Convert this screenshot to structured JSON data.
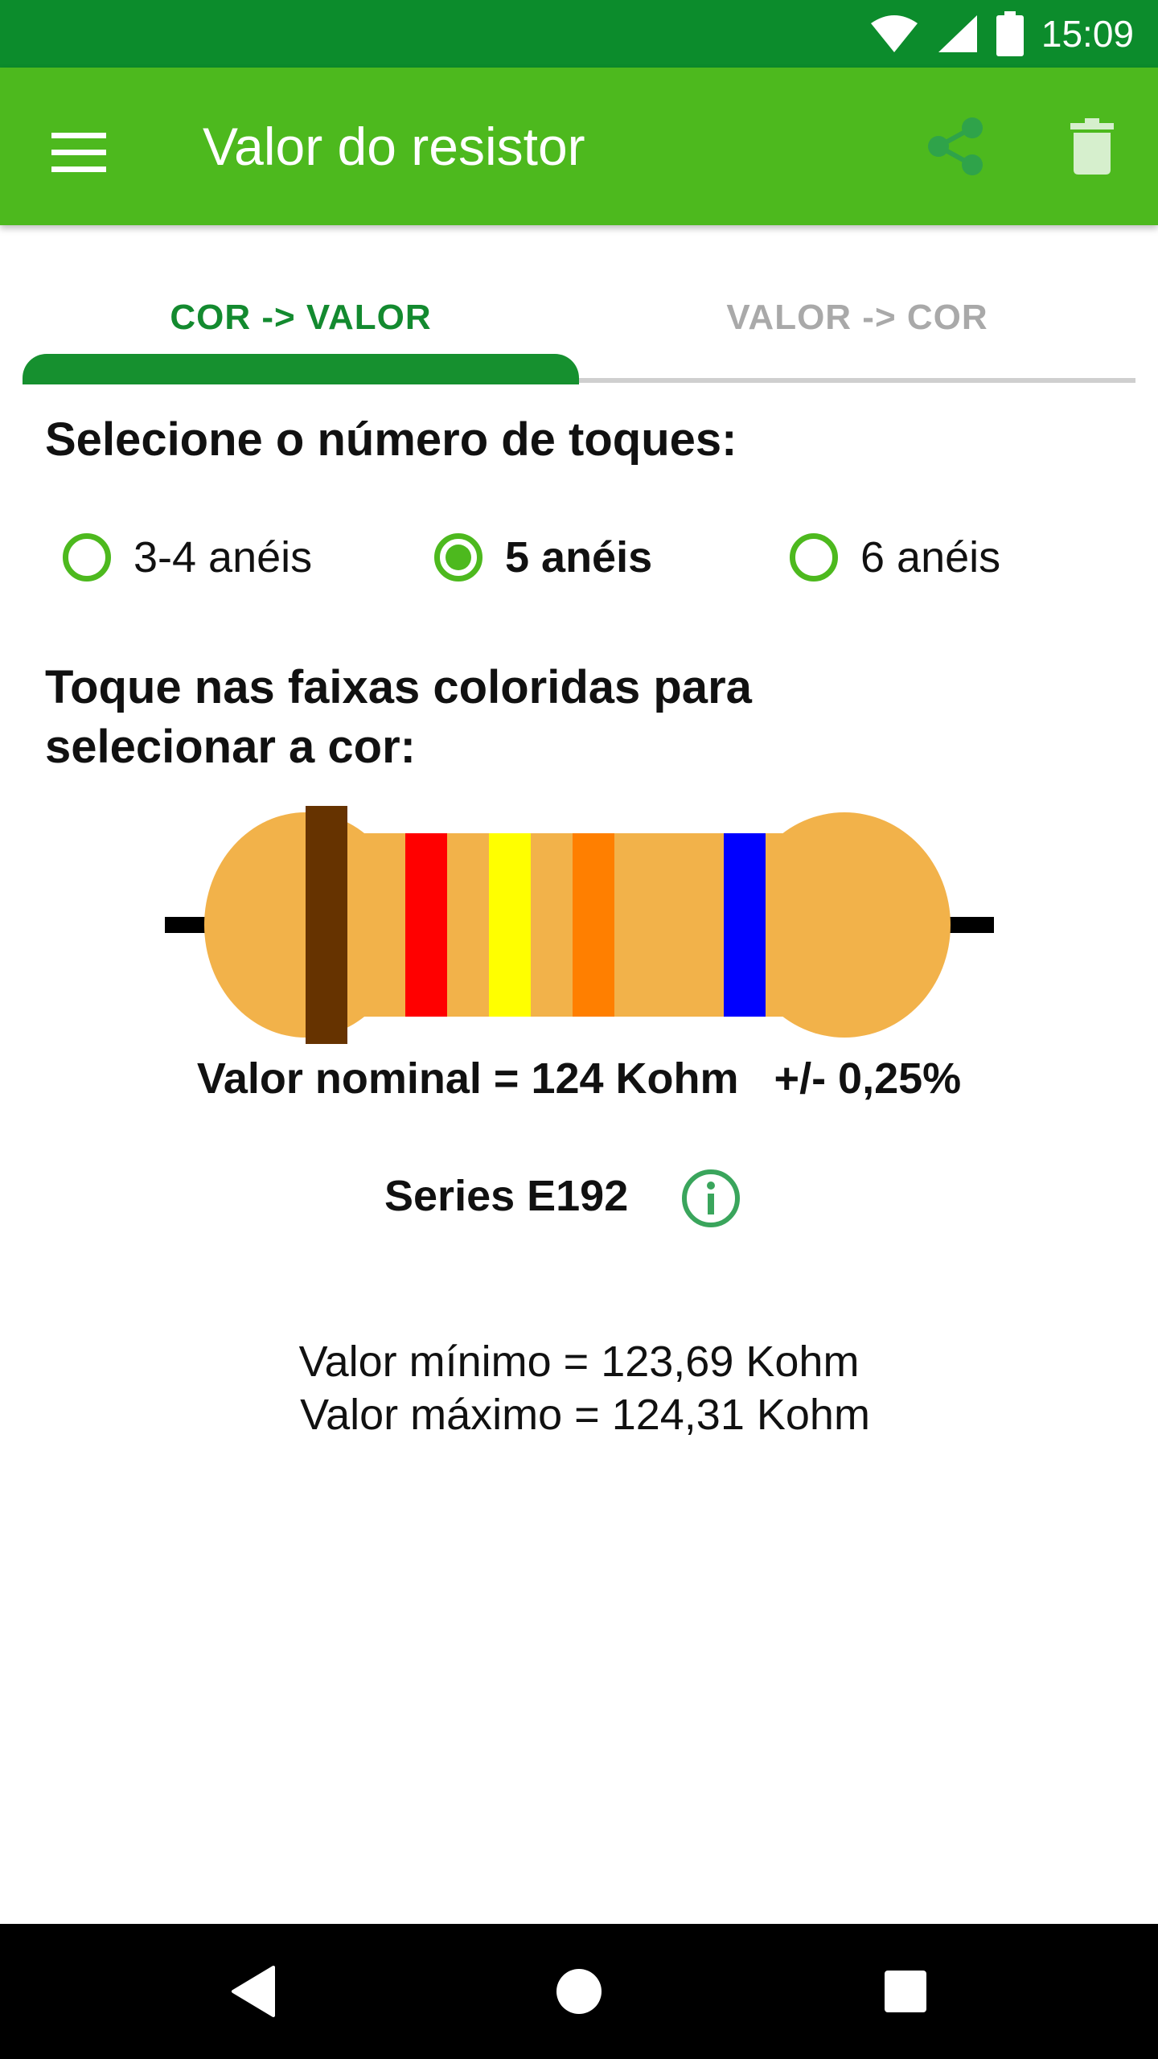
{
  "status_bar": {
    "time": "15:09"
  },
  "app_bar": {
    "title": "Valor do resistor",
    "icons": [
      "menu-icon",
      "share-icon",
      "delete-icon"
    ]
  },
  "tabs": [
    {
      "label": "COR -> VALOR",
      "active": true
    },
    {
      "label": "VALOR -> COR",
      "active": false
    }
  ],
  "rings_heading": "Selecione o número de toques:",
  "ring_options": [
    {
      "label": "3-4 anéis",
      "selected": false
    },
    {
      "label": "5 anéis",
      "selected": true
    },
    {
      "label": "6 anéis",
      "selected": false
    }
  ],
  "bands_heading_line1": "Toque nas faixas coloridas para",
  "bands_heading_line2": "selecionar a cor:",
  "resistor": {
    "body_color": "#f2b24a",
    "bands": [
      {
        "color_hex": "#663300"
      },
      {
        "color_hex": "#ff0000"
      },
      {
        "color_hex": "#ffff00"
      },
      {
        "color_hex": "#ff7f00"
      },
      {
        "color_hex": "#0000ff"
      }
    ]
  },
  "result": {
    "nominal": "Valor nominal = 124 Kohm",
    "tolerance": "+/- 0,25%",
    "series": "Series E192",
    "min": "Valor mínimo = 123,69 Kohm",
    "max": " Valor máximo = 124,31 Kohm"
  },
  "colors": {
    "status_bar": "#0c8c2c",
    "app_bar": "#4db91e",
    "tab_active": "#138a2f",
    "tab_inactive": "#a9a9a9"
  }
}
